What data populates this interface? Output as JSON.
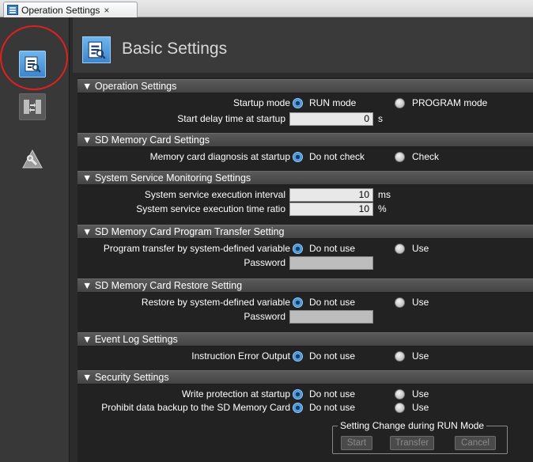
{
  "tab": {
    "label": "Operation Settings",
    "close": "×"
  },
  "header": {
    "title": "Basic Settings"
  },
  "sections": {
    "operation": {
      "title": "▼ Operation Settings",
      "startup_mode_label": "Startup mode",
      "run_mode": "RUN mode",
      "program_mode": "PROGRAM mode",
      "start_delay_label": "Start delay time at startup",
      "start_delay_value": "0",
      "start_delay_unit": "s"
    },
    "sd_card": {
      "title": "▼ SD Memory Card Settings",
      "diagnosis_label": "Memory card diagnosis at startup",
      "do_not_check": "Do not check",
      "check": "Check"
    },
    "service_monitor": {
      "title": "▼ System Service Monitoring Settings",
      "interval_label": "System service execution interval",
      "interval_value": "10",
      "interval_unit": "ms",
      "ratio_label": "System service execution time ratio",
      "ratio_value": "10",
      "ratio_unit": "%"
    },
    "program_transfer": {
      "title": "▼ SD Memory Card Program Transfer Setting",
      "transfer_label": "Program transfer by system-defined variable",
      "do_not_use": "Do not use",
      "use": "Use",
      "password_label": "Password"
    },
    "restore": {
      "title": "▼ SD Memory Card Restore Setting",
      "restore_label": "Restore by system-defined variable",
      "do_not_use": "Do not use",
      "use": "Use",
      "password_label": "Password"
    },
    "event_log": {
      "title": "▼ Event Log Settings",
      "instruction_label": "Instruction Error Output",
      "do_not_use": "Do not use",
      "use": "Use"
    },
    "security": {
      "title": "▼ Security Settings",
      "write_protect_label": "Write protection at startup",
      "prohibit_label": "Prohibit data backup to the SD Memory Card",
      "do_not_use": "Do not use",
      "use": "Use",
      "group_label": "Setting Change during RUN Mode",
      "start_btn": "Start",
      "transfer_btn": "Transfer",
      "cancel_btn": "Cancel"
    }
  },
  "colors": {
    "accent": "#3d86cc",
    "highlight_circle": "#e02020",
    "background": "#2b2b2b"
  }
}
